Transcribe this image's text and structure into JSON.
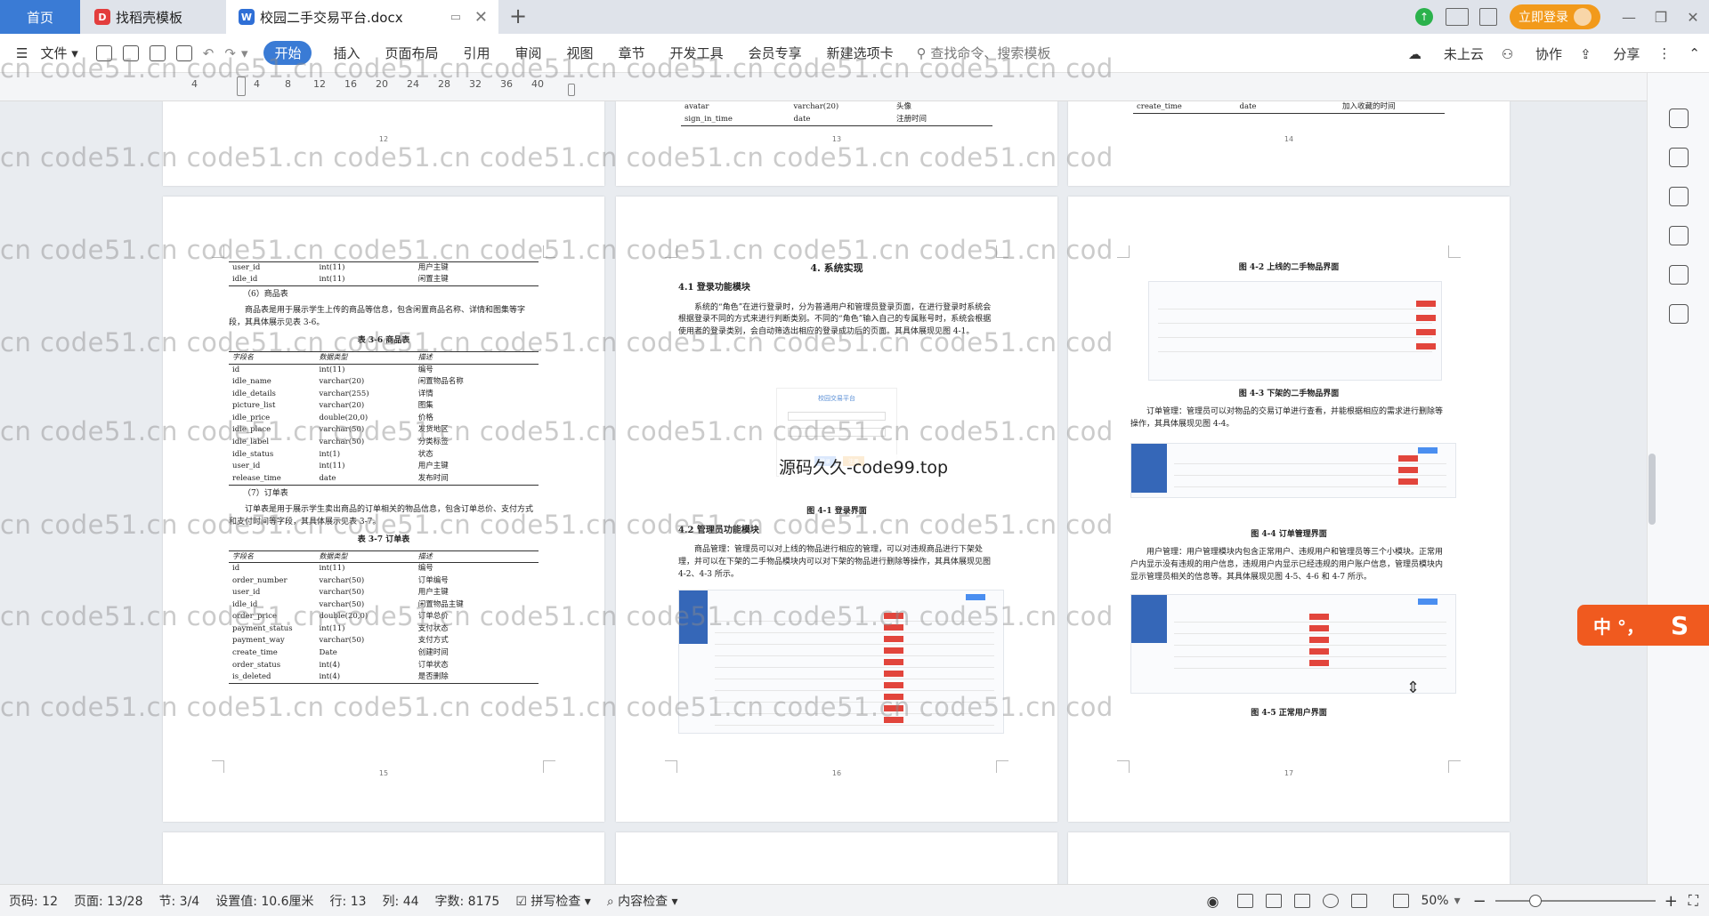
{
  "tabs": {
    "home": "首页",
    "templates": "找稻壳模板",
    "document": "校园二手交易平台.docx"
  },
  "titlebar": {
    "login_label": "立即登录"
  },
  "ribbon": {
    "file_label": "文件",
    "menu": [
      "开始",
      "插入",
      "页面布局",
      "引用",
      "审阅",
      "视图",
      "章节",
      "开发工具",
      "会员专享",
      "新建选项卡"
    ],
    "active_index": 0,
    "search_placeholder": "查找命令、搜索模板",
    "cloud_label": "未上云",
    "collab_label": "协作",
    "share_label": "分享"
  },
  "ruler": {
    "ticks": [
      "4",
      "4",
      "8",
      "12",
      "16",
      "20",
      "24",
      "28",
      "32",
      "36",
      "40"
    ]
  },
  "watermark": {
    "text": "cn    code51.cn    code51.cn    code51.cn    code51.cn    code51.cn    code51.cn    code51.cn    cod",
    "center_text": "源码久久-code99.top"
  },
  "pages_top": {
    "p12_number": "12",
    "p13_number": "13",
    "p14_number": "14",
    "p13_rows": [
      [
        "avatar",
        "varchar(20)",
        "头像"
      ],
      [
        "sign_in_time",
        "date",
        "注册时间"
      ]
    ],
    "p14_rows": [
      [
        "create_time",
        "date",
        "加入收藏的时间"
      ]
    ]
  },
  "page15": {
    "top_rows": [
      [
        "user_id",
        "int(11)",
        "用户主键"
      ],
      [
        "idle_id",
        "int(11)",
        "闲置主键"
      ]
    ],
    "s6_heading": "（6）商品表",
    "s6_para": "商品表是用于展示学生上传的商品等信息，包含闲置商品名称、详情和图集等字段，其具体展示见表 3-6。",
    "t36_caption": "表 3-6 商品表",
    "t36_header": [
      "字段名",
      "数据类型",
      "描述"
    ],
    "t36_rows": [
      [
        "id",
        "int(11)",
        "编号"
      ],
      [
        "idle_name",
        "varchar(20)",
        "闲置物品名称"
      ],
      [
        "idle_details",
        "varchar(255)",
        "详情"
      ],
      [
        "picture_list",
        "varchar(20)",
        "图集"
      ],
      [
        "idle_price",
        "double(20,0)",
        "价格"
      ],
      [
        "idle_place",
        "varchar(50)",
        "发货地区"
      ],
      [
        "idle_label",
        "varchar(50)",
        "分类标签"
      ],
      [
        "idle_status",
        "int(1)",
        "状态"
      ],
      [
        "user_id",
        "int(11)",
        "用户主键"
      ],
      [
        "release_time",
        "date",
        "发布时间"
      ]
    ],
    "s7_heading": "（7）订单表",
    "s7_para": "订单表是用于展示学生卖出商品的订单相关的物品信息，包含订单总价、支付方式和支付时间等字段，其具体展示见表 3-7。",
    "t37_caption": "表 3-7 订单表",
    "t37_header": [
      "字段名",
      "数据类型",
      "描述"
    ],
    "t37_rows": [
      [
        "id",
        "int(11)",
        "编号"
      ],
      [
        "order_number",
        "varchar(50)",
        "订单编号"
      ],
      [
        "user_id",
        "varchar(50)",
        "用户主键"
      ],
      [
        "idle_id",
        "varchar(50)",
        "闲置物品主键"
      ],
      [
        "order_price",
        "double(20,0)",
        "订单总价"
      ],
      [
        "payment_status",
        "int(11)",
        "支付状态"
      ],
      [
        "payment_way",
        "varchar(50)",
        "支付方式"
      ],
      [
        "create_time",
        "Date",
        "创建时间"
      ],
      [
        "order_status",
        "int(4)",
        "订单状态"
      ],
      [
        "is_deleted",
        "int(4)",
        "是否删除"
      ]
    ],
    "number": "15"
  },
  "page16": {
    "chapter": "4. 系统实现",
    "s41": "4.1 登录功能模块",
    "s41_para": "系统的“角色”在进行登录时，分为普通用户和管理员登录页面，在进行登录时系统会根据登录不同的方式来进行判断类别。不同的“角色”输入自己的专属账号时，系统会根据使用者的登录类别，会自动筛选出相应的登录成功后的页面。其具体展现见图 4-1。",
    "login_title": "校园交易平台",
    "login_btn1": "登录",
    "login_btn2": "注册",
    "fig41": "图 4-1 登录界面",
    "s42": "4.2 管理员功能模块",
    "s42_para": "商品管理：管理员可以对上线的物品进行相应的管理，可以对违规商品进行下架处理，并可以在下架的二手物品模块内可以对下架的物品进行删除等操作，其具体展现见图 4-2、4-3 所示。",
    "number": "16"
  },
  "page17": {
    "fig42": "图 4-2 上线的二手物品界面",
    "fig43": "图 4-3 下架的二手物品界面",
    "order_para": "订单管理：管理员可以对物品的交易订单进行查看，并能根据相应的需求进行删除等操作，其具体展现见图 4-4。",
    "fig44": "图 4-4 订单管理界面",
    "user_para": "用户管理：用户管理模块内包含正常用户、违规用户和管理员等三个小模块。正常用户内显示没有违规的用户信息，违规用户内显示已经违规的用户账户信息，管理员模块内显示管理员相关的信息等。其具体展现见图 4-5、4-6 和 4-7 所示。",
    "fig45": "图 4-5 正常用户界面",
    "number": "17"
  },
  "status": {
    "page_code": "页码: 12",
    "page": "页面: 13/28",
    "section": "节: 3/4",
    "setting": "设置值: 10.6厘米",
    "row": "行: 13",
    "col": "列: 44",
    "words": "字数: 8175",
    "spell": "拼写检查",
    "content": "内容检查",
    "zoom": "50%"
  },
  "overlay": {
    "badge_text": "中 °，"
  }
}
